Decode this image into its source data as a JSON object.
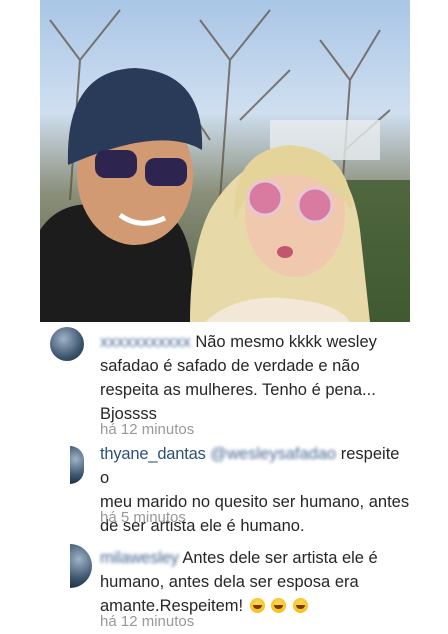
{
  "photo": {
    "description_icon": "selfie-photo"
  },
  "comments": [
    {
      "username": "",
      "text_lines": [
        "Não mesmo kkkk wesley",
        "safadao é safado de verdade e não",
        "respeita as mulheres. Tenho é pena...",
        "Bjossss"
      ],
      "time": "há 12 minutos"
    },
    {
      "username": "thyane_dantas",
      "mention": "@wesleysafadao",
      "text_lines": [
        "respeite o",
        "meu marido no quesito ser humano, antes",
        "de ser artista ele é humano."
      ],
      "time": "há 5 minutos"
    },
    {
      "username": "milawesley",
      "text_lines": [
        "Antes dele ser artista ele é",
        "humano, antes dela ser esposa era",
        "amante.Respeitem!"
      ],
      "emojis": [
        "grinning-emoji",
        "grinning-emoji",
        "grinning-emoji"
      ],
      "time": "há 12 minutos"
    }
  ]
}
